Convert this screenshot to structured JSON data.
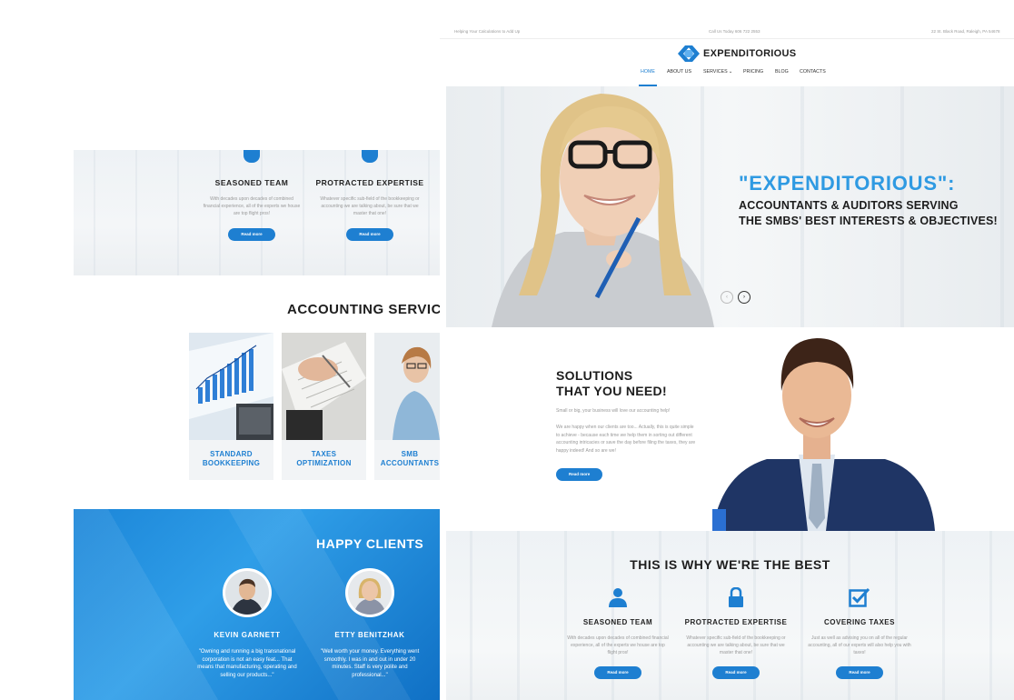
{
  "back": {
    "features": [
      {
        "title": "SEASONED TEAM",
        "text": "With decades upon decades of combined financial experience, all of the experts we house are top flight pros!",
        "button": "Read more"
      },
      {
        "title": "PROTRACTED EXPERTISE",
        "text": "Whatever specific sub-field of the bookkeeping or accounting we are talking about, be sure that we master that one!",
        "button": "Read more"
      }
    ],
    "services_title": "ACCOUNTING SERVICES",
    "services": [
      {
        "label": "STANDARD\nBOOKKEEPING"
      },
      {
        "label": "TAXES\nOPTIMIZATION"
      },
      {
        "label": "SMB\nACCOUNTANTS"
      }
    ],
    "clients_title": "HAPPY CLIENTS",
    "clients": [
      {
        "name": "KEVIN GARNETT",
        "quote": "\"Owning and running a big transnational corporation is not an easy feat... That means that manufacturing, operating and selling our products...\""
      },
      {
        "name": "ETTY BENITZHAK",
        "quote": "\"Well worth your money. Everything went smoothly. I was in and out in under 20 minutes. Staff is very polite and professional...\""
      }
    ]
  },
  "front": {
    "topbar": {
      "tagline": "Helping Your Calculations to Add Up",
      "phone": "Call Us Today 606 722 2553",
      "address": "22 St. Black Road, Raleigh, PA 54678"
    },
    "brand": "EXPENDITORIOUS",
    "nav": {
      "home": "HOME",
      "about": "ABOUT US",
      "services": "SERVICES",
      "services_caret": "⌄",
      "pricing": "PRICING",
      "blog": "BLOG",
      "contacts": "CONTACTS"
    },
    "hero": {
      "title": "\"EXPENDITORIOUS\":",
      "line1": "ACCOUNTANTS & AUDITORS SERVING",
      "line2": "THE SMBS' BEST INTERESTS & OBJECTIVES!",
      "prev": "‹",
      "next": "›"
    },
    "solutions": {
      "line1": "SOLUTIONS",
      "line2": "THAT YOU NEED!",
      "lead": "Small or big, your business will love our accounting help!",
      "body": "We are happy when our clients are too... Actually, this is quite simple to achieve - because each time we help them in sorting out different accounting intricacies or save the day before filing the taxes, they are happy indeed! And so are we!",
      "button": "Read more"
    },
    "best": {
      "title": "THIS IS WHY WE'RE THE BEST",
      "cols": [
        {
          "title": "SEASONED TEAM",
          "text": "With decades upon decades of combined financial experience, all of the experts we house are top flight pros!",
          "button": "Read more"
        },
        {
          "title": "PROTRACTED EXPERTISE",
          "text": "Whatever specific sub-field of the bookkeeping or accounting we are talking about, be sure that we master that one!",
          "button": "Read more"
        },
        {
          "title": "COVERING TAXES",
          "text": "Just as well as advising you on all of the regular accounting, all of our experts will also help you with taxes!",
          "button": "Read more"
        }
      ]
    }
  },
  "colors": {
    "accent": "#1e7fd1",
    "hero_title": "#2f9ae2",
    "clients_bg": "#1c86d8"
  }
}
